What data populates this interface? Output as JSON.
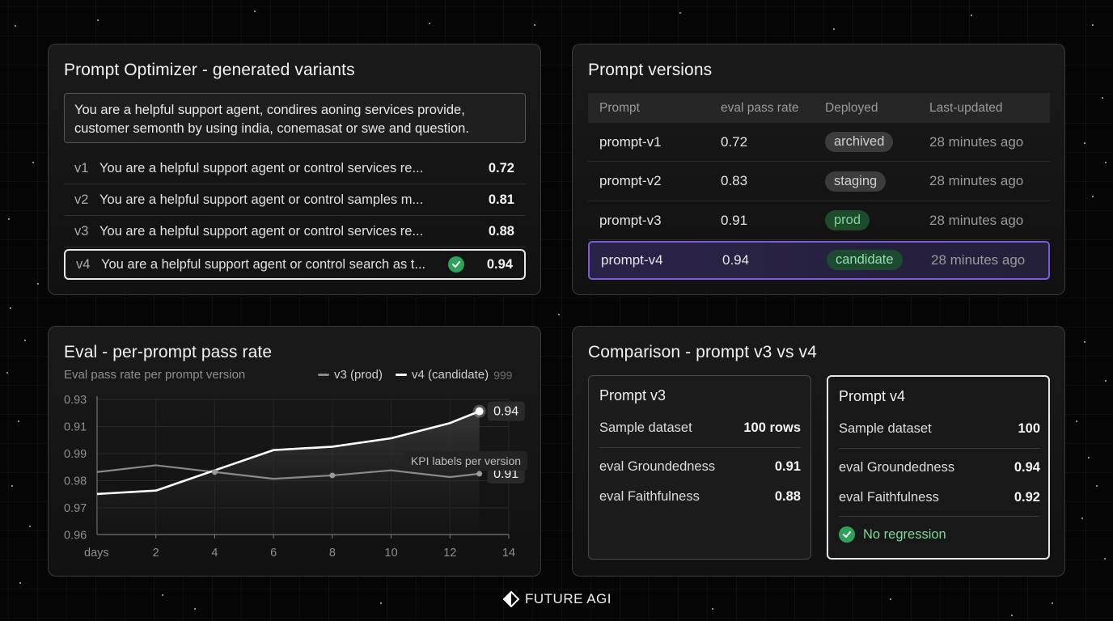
{
  "optimizer": {
    "title": "Prompt Optimizer - generated variants",
    "seed_text": "You are a helpful support agent, condires aoning services provide, customer semonth by using india, conemasat or swe and question.",
    "variants": [
      {
        "id": "v1",
        "text": "You are a helpful support agent or control services re...",
        "score": "0.72",
        "selected": false
      },
      {
        "id": "v2",
        "text": "You are a helpful support agent or control samples m...",
        "score": "0.81",
        "selected": false
      },
      {
        "id": "v3",
        "text": "You are a helpful support agent or control services re...",
        "score": "0.88",
        "selected": false
      },
      {
        "id": "v4",
        "text": "You are a helpful support agent or control search as t...",
        "score": "0.94",
        "selected": true
      }
    ]
  },
  "versions": {
    "title": "Prompt versions",
    "columns": [
      "Prompt",
      "eval pass rate",
      "Deployed",
      "Last-updated"
    ],
    "rows": [
      {
        "prompt": "prompt-v1",
        "rate": "0.72",
        "status": "archived",
        "updated": "28 minutes ago"
      },
      {
        "prompt": "prompt-v2",
        "rate": "0.83",
        "status": "staging",
        "updated": "28 minutes ago"
      },
      {
        "prompt": "prompt-v3",
        "rate": "0.91",
        "status": "prod",
        "updated": "28 minutes ago"
      },
      {
        "prompt": "prompt-v4",
        "rate": "0.94",
        "status": "candidate",
        "updated": "28 minutes ago"
      }
    ]
  },
  "eval_chart": {
    "title": "Eval - per-prompt pass rate",
    "subtitle": "Eval pass rate per prompt version",
    "legend_extra": "999",
    "annotation": "KPI labels per version",
    "end_labels": [
      "0.94",
      "0.91"
    ]
  },
  "chart_data": {
    "type": "line",
    "title": "Eval - per-prompt pass rate",
    "subtitle": "Eval pass rate per prompt version",
    "xlabel": "days",
    "x_ticks": [
      2,
      4,
      6,
      8,
      10,
      12,
      14
    ],
    "y_tick_labels": [
      "0.93",
      "0.91",
      "0.99",
      "0.98",
      "0.97",
      "0.96"
    ],
    "x": [
      0,
      2,
      4,
      6,
      8,
      10,
      12,
      13
    ],
    "series": [
      {
        "name": "v3 (prod)",
        "color": "#8a8a8a",
        "values": [
          0.912,
          0.916,
          0.912,
          0.908,
          0.91,
          0.913,
          0.909,
          0.911
        ]
      },
      {
        "name": "v4 (candidate)",
        "color": "#ffffff",
        "values": [
          0.899,
          0.901,
          0.913,
          0.925,
          0.927,
          0.932,
          0.941,
          0.948
        ]
      }
    ],
    "legend": "top-right",
    "grid": true
  },
  "comparison": {
    "title": "Comparison - prompt v3 vs v4",
    "left": {
      "title": "Prompt v3",
      "dataset_label": "Sample dataset",
      "dataset_value": "100 rows",
      "metric1_label": "eval Groundedness",
      "metric1_value": "0.91",
      "metric2_label": "eval Faithfulness",
      "metric2_value": "0.88"
    },
    "right": {
      "title": "Prompt v4",
      "dataset_label": "Sample dataset",
      "dataset_value": "100",
      "metric1_label": "eval Groundedness",
      "metric1_value": "0.94",
      "metric2_label": "eval Faithfulness",
      "metric2_value": "0.92",
      "status": "No regression"
    }
  },
  "brand": {
    "name": "FUTURE AGI"
  },
  "colors": {
    "accent_purple": "#7a5cd6",
    "success_green": "#2fa25a"
  }
}
